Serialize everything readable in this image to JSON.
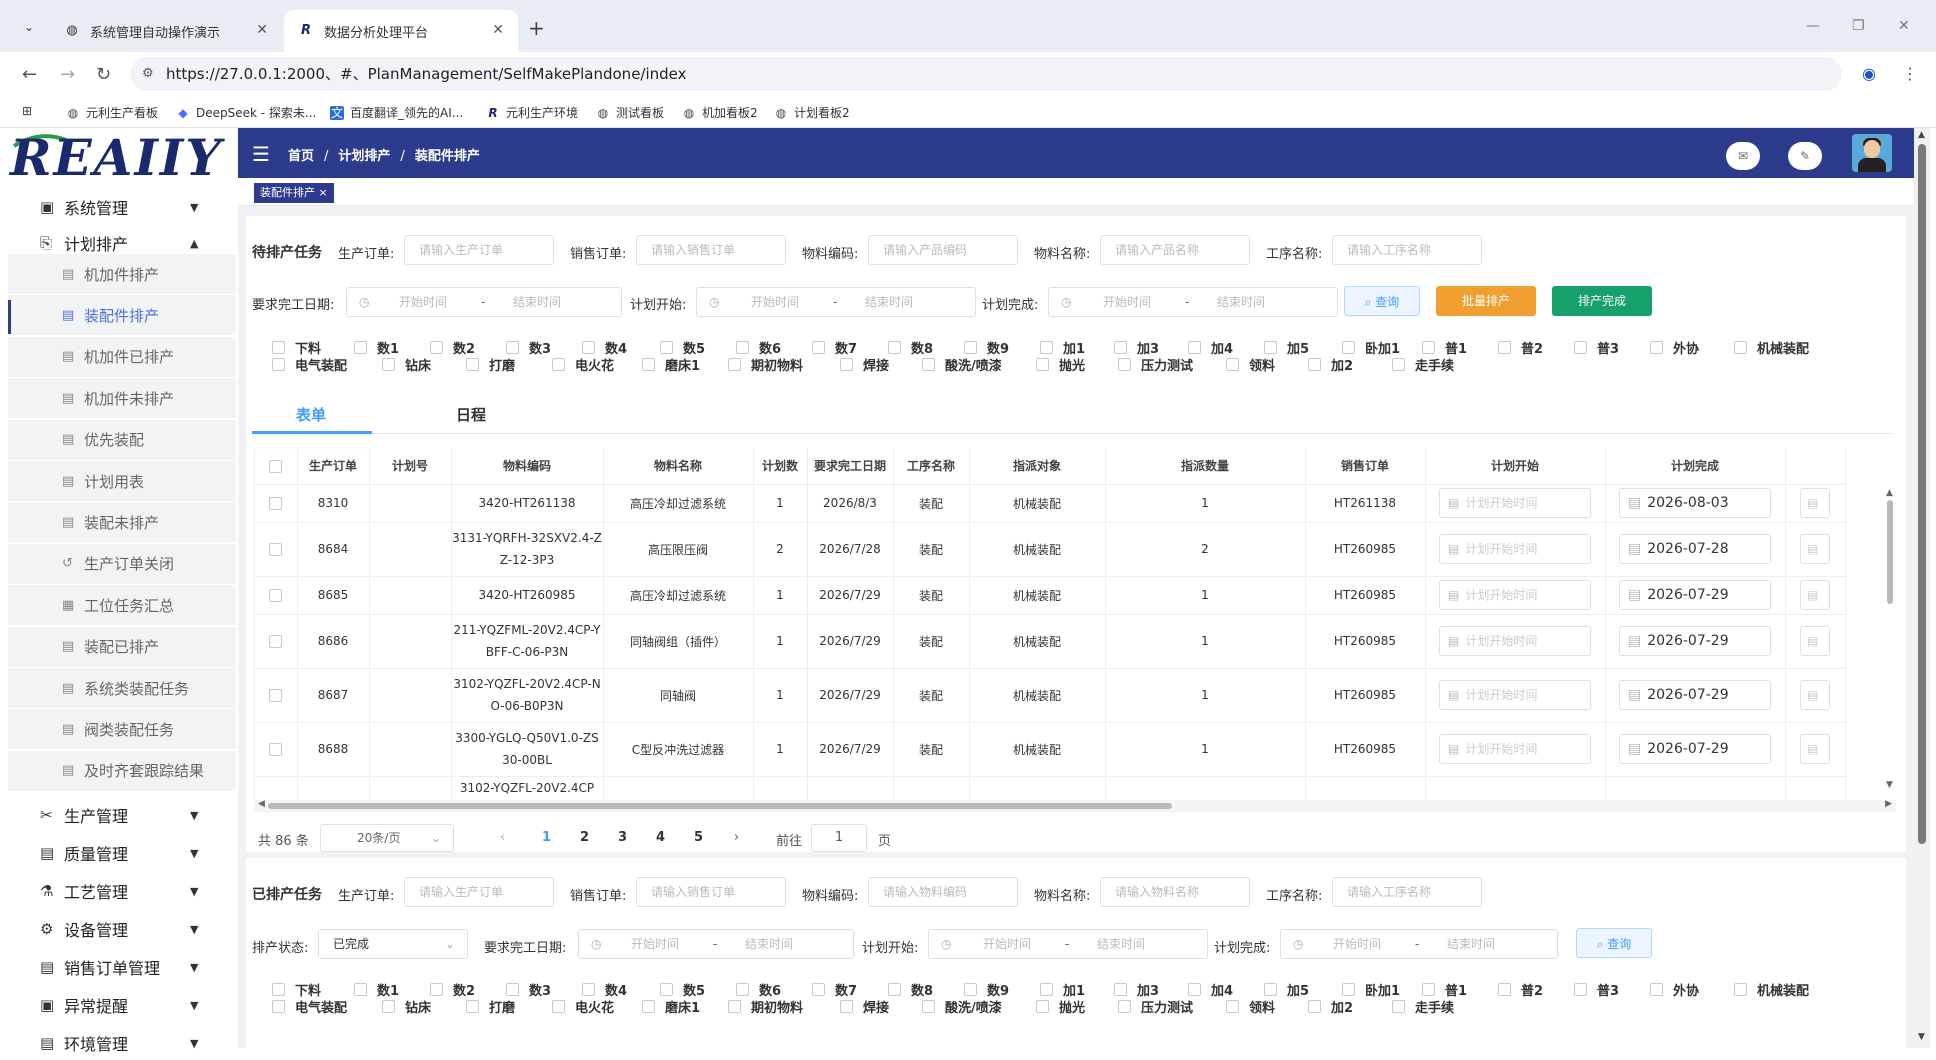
{
  "browser": {
    "tabs": [
      {
        "title": "系统管理自动操作演示"
      },
      {
        "title": "数据分析处理平台"
      }
    ],
    "url": "https://27.0.0.1:2000、#、PlanManagement/SelfMakePlandone/index",
    "bookmarks": [
      "元利生产看板",
      "DeepSeek - 探索未...",
      "百度翻译_领先的AI...",
      "元利生产环境",
      "测试看板",
      "机加看板2",
      "计划看板2"
    ]
  },
  "logo_text": "REAIIY",
  "sidebar": {
    "sections": [
      {
        "label": "系统管理"
      },
      {
        "label": "计划排产"
      }
    ],
    "sub_items": [
      "机加件排产",
      "装配件排产",
      "机加件已排产",
      "机加件未排产",
      "优先装配",
      "计划用表",
      "装配未排产",
      "生产订单关闭",
      "工位任务汇总",
      "装配已排产",
      "系统类装配任务",
      "阀类装配任务",
      "及时齐套跟踪结果"
    ],
    "lower_sections": [
      "生产管理",
      "质量管理",
      "工艺管理",
      "设备管理",
      "销售订单管理",
      "异常提醒",
      "环境管理"
    ]
  },
  "header": {
    "breadcrumb": [
      "首页",
      "计划排产",
      "装配件排产"
    ]
  },
  "page_tag": "装配件排产",
  "pending": {
    "title": "待排产任务",
    "labels": {
      "prod_order": "生产订单:",
      "sales_order": "销售订单:",
      "mat_code": "物料编码:",
      "mat_name": "物料名称:",
      "process": "工序名称:",
      "req_date": "要求完工日期:",
      "plan_start": "计划开始:",
      "plan_end": "计划完成:"
    },
    "placeholders": {
      "prod_order": "请输入生产订单",
      "sales_order": "请输入销售订单",
      "mat_code": "请输入产品编码",
      "mat_name": "请输入产品名称",
      "process": "请输入工序名称",
      "start": "开始时间",
      "end": "结束时间"
    },
    "buttons": {
      "query": "查询",
      "batch": "批量排产",
      "done": "排产完成"
    }
  },
  "checkbox_row1": [
    "下料",
    "数1",
    "数2",
    "数3",
    "数4",
    "数5",
    "数6",
    "数7",
    "数8",
    "数9",
    "加1",
    "加3",
    "加4",
    "加5",
    "卧加1",
    "普1",
    "普2",
    "普3",
    "外协",
    "机械装配"
  ],
  "checkbox_row2": [
    "电气装配",
    "钻床",
    "打磨",
    "电火花",
    "磨床1",
    "期初物料",
    "焊接",
    "酸洗/喷漆",
    "抛光",
    "压力测试",
    "领料",
    "加2",
    "走手续"
  ],
  "view_tabs": [
    "表单",
    "日程"
  ],
  "table": {
    "headers": [
      "生产订单",
      "计划号",
      "物料编码",
      "物料名称",
      "计划数",
      "要求完工日期",
      "工序名称",
      "指派对象",
      "指派数量",
      "销售订单",
      "计划开始",
      "计划完成"
    ],
    "start_placeholder": "计划开始时间",
    "rows": [
      {
        "order": "8310",
        "plan_no": "",
        "code": "3420-HT261138",
        "name": "高压冷却过滤系统",
        "qty": "1",
        "req": "2026/8/3",
        "proc": "装配",
        "assignee": "机械装配",
        "assign_qty": "1",
        "sales": "HT261138",
        "end": "2026-08-03"
      },
      {
        "order": "8684",
        "plan_no": "",
        "code": "3131-YQRFH-32SXV2.4-ZZ-12-3P3",
        "name": "高压限压阀",
        "qty": "2",
        "req": "2026/7/28",
        "proc": "装配",
        "assignee": "机械装配",
        "assign_qty": "2",
        "sales": "HT260985",
        "end": "2026-07-28"
      },
      {
        "order": "8685",
        "plan_no": "",
        "code": "3420-HT260985",
        "name": "高压冷却过滤系统",
        "qty": "1",
        "req": "2026/7/29",
        "proc": "装配",
        "assignee": "机械装配",
        "assign_qty": "1",
        "sales": "HT260985",
        "end": "2026-07-29"
      },
      {
        "order": "8686",
        "plan_no": "",
        "code": "211-YQZFML-20V2.4CP-YBFF-C-06-P3N",
        "name": "同轴阀组（插件）",
        "qty": "1",
        "req": "2026/7/29",
        "proc": "装配",
        "assignee": "机械装配",
        "assign_qty": "1",
        "sales": "HT260985",
        "end": "2026-07-29"
      },
      {
        "order": "8687",
        "plan_no": "",
        "code": "3102-YQZFL-20V2.4CP-NO-06-B0P3N",
        "name": "同轴阀",
        "qty": "1",
        "req": "2026/7/29",
        "proc": "装配",
        "assignee": "机械装配",
        "assign_qty": "1",
        "sales": "HT260985",
        "end": "2026-07-29"
      },
      {
        "order": "8688",
        "plan_no": "",
        "code": "3300-YGLQ-Q50V1.0-ZS30-00BL",
        "name": "C型反冲洗过滤器",
        "qty": "1",
        "req": "2026/7/29",
        "proc": "装配",
        "assignee": "机械装配",
        "assign_qty": "1",
        "sales": "HT260985",
        "end": "2026-07-29"
      },
      {
        "order": "",
        "plan_no": "",
        "code": "3102-YQZFL-20V2.4CP",
        "name": "",
        "qty": "",
        "req": "",
        "proc": "",
        "assignee": "",
        "assign_qty": "",
        "sales": "",
        "end": ""
      }
    ]
  },
  "pagination": {
    "total": "共 86 条",
    "size": "20条/页",
    "pages": [
      "1",
      "2",
      "3",
      "4",
      "5"
    ],
    "goto_prefix": "前往",
    "goto_value": "1",
    "goto_suffix": "页"
  },
  "done": {
    "title": "已排产任务",
    "labels": {
      "prod_order": "生产订单:",
      "sales_order": "销售订单:",
      "mat_code": "物料编码:",
      "mat_name": "物料名称:",
      "process": "工序名称:",
      "status": "排产状态:",
      "req_date": "要求完工日期:",
      "plan_start": "计划开始:",
      "plan_end": "计划完成:"
    },
    "placeholders": {
      "prod_order": "请输入生产订单",
      "sales_order": "请输入销售订单",
      "mat_code": "请输入物料编码",
      "mat_name": "请输入物料名称",
      "process": "请输入工序名称",
      "start": "开始时间",
      "end": "结束时间"
    },
    "status_value": "已完成",
    "query": "查询"
  }
}
